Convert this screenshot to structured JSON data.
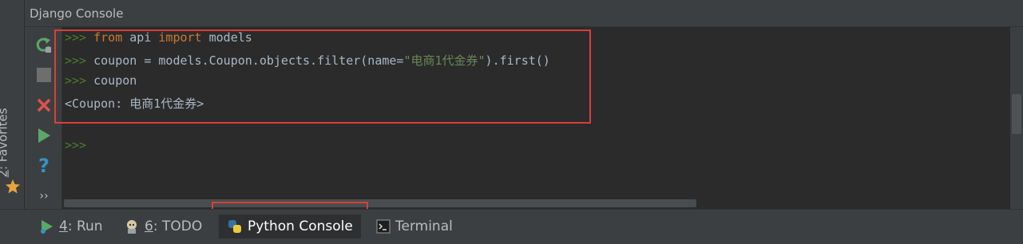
{
  "title": "Django Console",
  "favorites_tab": {
    "number": "2",
    "label": ": Favorites"
  },
  "console": {
    "prompt": ">>>",
    "lines": [
      {
        "kw1": "from",
        "t1": " api ",
        "kw2": "import",
        "t2": " models"
      },
      {
        "pre": "coupon = models.Coupon.objects.filter(name=",
        "str": "\"电商1代金券\"",
        "post": ").first()"
      },
      {
        "text": "coupon"
      }
    ],
    "output": "<Coupon: 电商1代金券>"
  },
  "bottom_tabs": [
    {
      "mnemonic": "4",
      "label": ": Run",
      "icon": "run-icon"
    },
    {
      "mnemonic": "6",
      "label": ": TODO",
      "icon": "todo-icon"
    },
    {
      "label": "Python Console",
      "icon": "python-icon",
      "active": true
    },
    {
      "label": "Terminal",
      "icon": "terminal-icon"
    }
  ],
  "toolbar_icons": [
    "rerun-icon",
    "stop-icon",
    "close-icon",
    "execute-icon",
    "help-icon",
    "more-icon"
  ],
  "colors": {
    "accent_highlight": "#d9403a",
    "prompt": "#4e7a2a",
    "keyword": "#cc7832",
    "string": "#6a8759"
  }
}
